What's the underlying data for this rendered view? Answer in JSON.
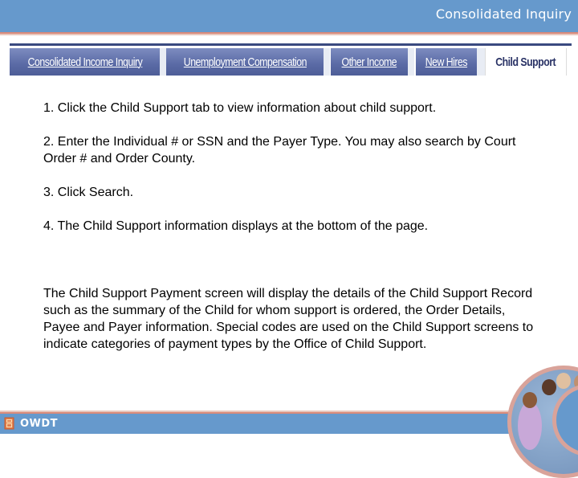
{
  "header": {
    "title": "Consolidated Inquiry"
  },
  "tabs": [
    {
      "label": "Consolidated Income Inquiry",
      "active": false
    },
    {
      "label": "Unemployment Compensation",
      "active": false
    },
    {
      "label": "Other Income",
      "active": false
    },
    {
      "label": "New Hires",
      "active": false
    },
    {
      "label": "Child Support",
      "active": true
    }
  ],
  "instructions": {
    "steps": [
      "1.  Click the Child Support tab to view information about child support.",
      "2.  Enter the Individual # or SSN and the Payer Type.  You may also search by Court Order # and Order County.",
      "3.  Click Search.",
      "4.  The Child Support information displays at the bottom of the page."
    ],
    "description": "The Child Support Payment screen will display the details of the Child Support Record such as the summary of the Child for whom support is ordered, the Order Details, Payee and Payer information.  Special codes are used on the Child Support screens to indicate categories of payment types by the Office of Child Support."
  },
  "footer": {
    "logo_text": "OWDT",
    "logo_icon": "owdt-logo-icon",
    "photo": "family-photo-circle"
  },
  "colors": {
    "header_blue": "#6699cc",
    "accent_salmon": "#d98a7a",
    "tab_blue": "#5a6aa5",
    "tab_active_text": "#2a3366"
  }
}
